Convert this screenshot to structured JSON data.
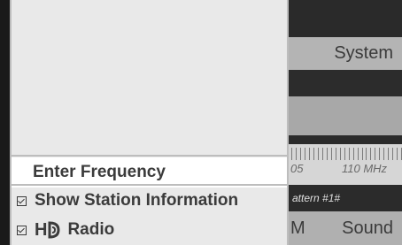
{
  "background": {
    "system_button": "System",
    "frequency_labels": [
      "05",
      "110 MHz"
    ],
    "pattern_label": "attern #1#",
    "bottom_left_label": "M",
    "sound_button": "Sound"
  },
  "menu": {
    "items": [
      {
        "label": "Enter Frequency",
        "selected": true
      },
      {
        "label": "Show Station Information",
        "checked": true
      },
      {
        "label": "Radio",
        "checked": true,
        "icon": "hd-radio-logo",
        "logo_text": "H"
      }
    ]
  },
  "colors": {
    "menu_bg": "#e9e9e9",
    "highlight": "#ffffff",
    "text": "#3b3b3b"
  }
}
